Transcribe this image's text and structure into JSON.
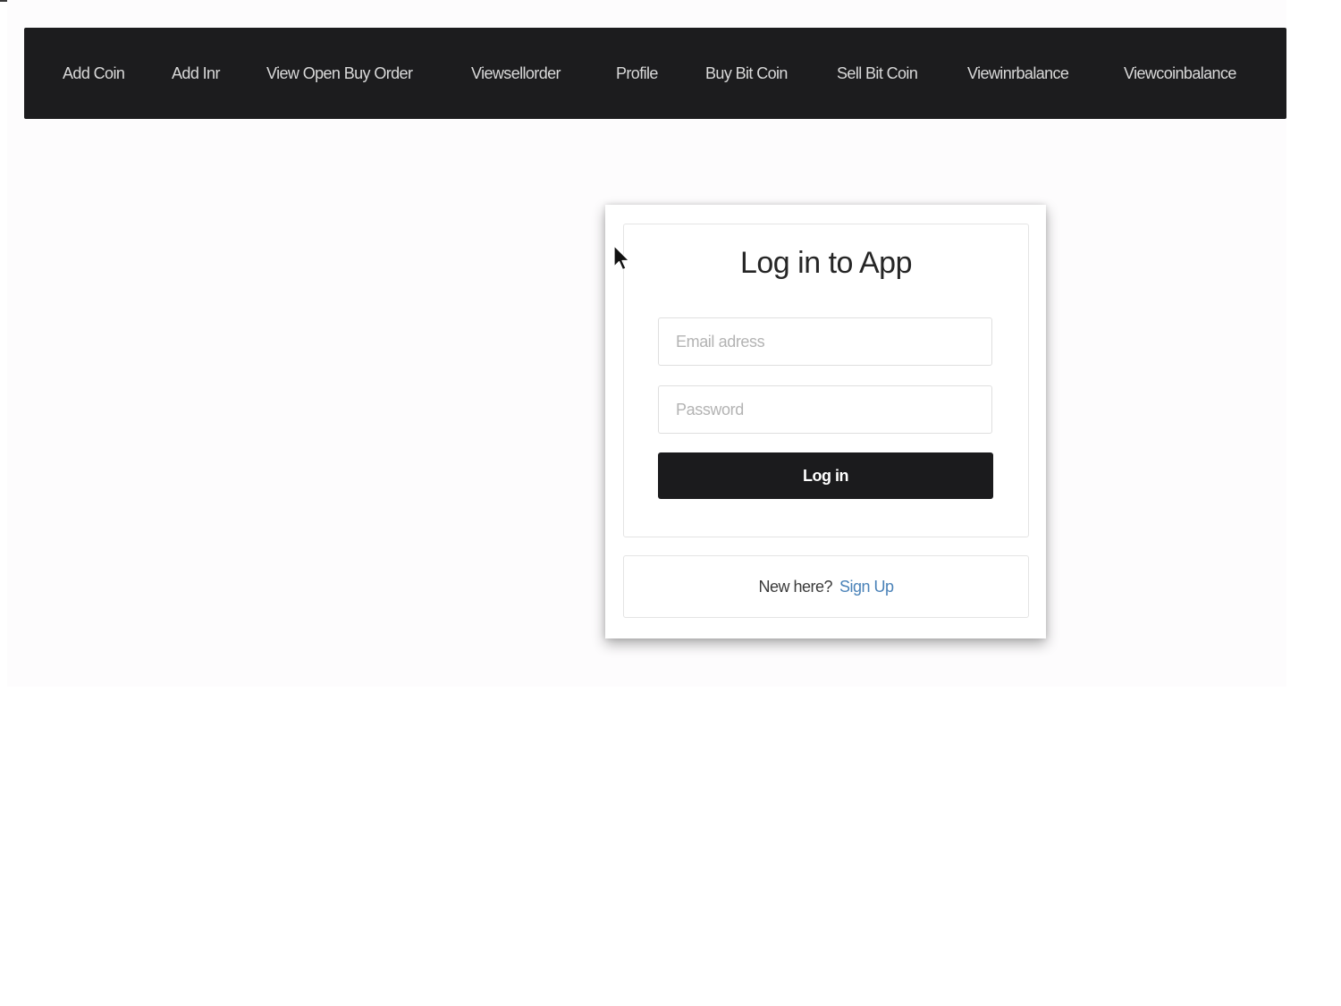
{
  "navbar": {
    "items": [
      {
        "label": "Add Coin"
      },
      {
        "label": "Add Inr"
      },
      {
        "label": "View Open Buy Order"
      },
      {
        "label": "Viewsellorder"
      },
      {
        "label": "Profile"
      },
      {
        "label": "Buy Bit Coin"
      },
      {
        "label": "Sell Bit Coin"
      },
      {
        "label": "Viewinrbalance"
      },
      {
        "label": "Viewcoinbalance"
      }
    ]
  },
  "login": {
    "title": "Log in to App",
    "email_placeholder": "Email adress",
    "email_value": "",
    "password_placeholder": "Password",
    "password_value": "",
    "submit_label": "Log in"
  },
  "signup": {
    "prompt": "New here?",
    "link_label": "Sign Up",
    "link_color": "#4a82b8"
  },
  "colors": {
    "navbar_bg": "#1c1c1e",
    "button_bg": "#1b1b1d",
    "page_bg": "#fdfcfd"
  },
  "icons": {
    "cursor": "mouse-pointer-icon"
  }
}
